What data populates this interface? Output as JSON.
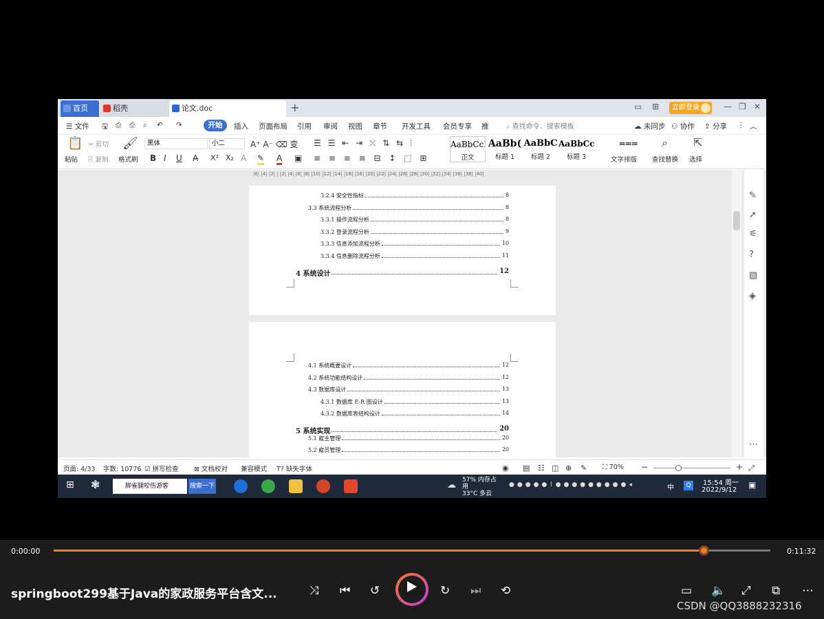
{
  "titlebar": {
    "tabs": [
      {
        "label": "首页"
      },
      {
        "label": "稻壳"
      },
      {
        "label": "论文.doc"
      }
    ],
    "login_label": "立即登录"
  },
  "menubar": {
    "file_label": "文件",
    "items": [
      "开始",
      "插入",
      "页面布局",
      "引用",
      "审阅",
      "视图",
      "章节",
      "开发工具",
      "会员专享",
      "推"
    ],
    "search_placeholder": "查找命令、搜索模板",
    "sync_label": "未同步",
    "collab_label": "协作",
    "share_label": "分享"
  },
  "ribbon": {
    "paste_label": "粘贴",
    "cut_label": "剪切",
    "copy_label": "复制",
    "format_painter_label": "格式刷",
    "font_name": "黑体",
    "font_size": "小二",
    "styles": [
      {
        "preview": "AaBbCcI",
        "name": "正文"
      },
      {
        "preview": "AaBb(",
        "name": "标题 1"
      },
      {
        "preview": "AaBbC",
        "name": "标题 2"
      },
      {
        "preview": "AaBbCcI",
        "name": "标题 3"
      }
    ],
    "text_layout_label": "文字排版",
    "find_replace_label": "查找替换",
    "select_label": "选择"
  },
  "ruler_text": "|6| |4| |2| | |2| |4| |6| |8| |10| |12| |14| |16| |18| |20| |22| |24| |26| |28| |30| |32| |34| |36| |38| |40|",
  "toc_page1": [
    {
      "text": "3.2.4  安全性指标",
      "page": "8",
      "level": 3
    },
    {
      "text": "3.3 系统流程分析",
      "page": "8",
      "level": 2
    },
    {
      "text": "3.3.1  操作流程分析",
      "page": "8",
      "level": 3
    },
    {
      "text": "3.3.2  登录流程分析",
      "page": "9",
      "level": 3
    },
    {
      "text": "3.3.3  信息添加流程分析",
      "page": "10",
      "level": 3
    },
    {
      "text": "3.3.4  信息删除流程分析",
      "page": "11",
      "level": 3
    },
    {
      "text": "4  系统设计",
      "page": "12",
      "level": 1
    }
  ],
  "toc_page2": [
    {
      "text": "4.1 系统概要设计",
      "page": "12",
      "level": 2
    },
    {
      "text": "4.2 系统功能结构设计",
      "page": "12",
      "level": 2
    },
    {
      "text": "4.3 数据库设计",
      "page": "13",
      "level": 2
    },
    {
      "text": "4.3.1  数据库 E-R 图设计",
      "page": "13",
      "level": 3
    },
    {
      "text": "4.3.2  数据库表结构设计",
      "page": "14",
      "level": 3
    },
    {
      "text": "5  系统实现",
      "page": "20",
      "level": 1
    },
    {
      "text": "5.1 雇主管理",
      "page": "20",
      "level": 2
    },
    {
      "text": "5.2 雇员管理",
      "page": "20",
      "level": 2
    }
  ],
  "statusbar": {
    "page_info": "页面: 4/33",
    "word_count": "字数: 10776",
    "spell_check": "拼写检查",
    "doc_proof": "文档校对",
    "compat_mode": "兼容模式",
    "missing_fonts": "缺失字体",
    "zoom": "70%"
  },
  "taskbar": {
    "search_text": "脚雀腿咬伤游客",
    "search_button": "搜索一下",
    "weather": "33°C 多云",
    "memory": "57% 内存占用",
    "ime": "中",
    "time": "15:54 周一",
    "date": "2022/9/12"
  },
  "player": {
    "current_time": "0:00:00",
    "total_time": "0:11:32",
    "progress": 0.907,
    "title": "springboot299基于Java的家政服务平台含文...",
    "watermark": "CSDN @QQ3888232316"
  }
}
